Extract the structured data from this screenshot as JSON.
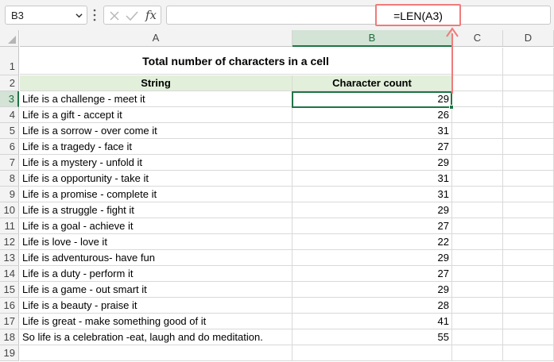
{
  "namebox": {
    "value": "B3"
  },
  "formula_bar": {
    "fx_label": "fx",
    "formula": "=LEN(A3)"
  },
  "columns": [
    "A",
    "B",
    "C",
    "D"
  ],
  "rows": [
    "1",
    "2",
    "3",
    "4",
    "5",
    "6",
    "7",
    "8",
    "9",
    "10",
    "11",
    "12",
    "13",
    "14",
    "15",
    "16",
    "17",
    "18",
    "19"
  ],
  "sheet": {
    "title": "Total number of characters in a cell",
    "header_string": "String",
    "header_count": "Character count",
    "data": [
      {
        "string": "Life is a challenge - meet it",
        "count": "29"
      },
      {
        "string": "Life is a gift - accept it",
        "count": "26"
      },
      {
        "string": "Life is a sorrow - over come it",
        "count": "31"
      },
      {
        "string": "Life is a tragedy - face it",
        "count": "27"
      },
      {
        "string": "Life is a mystery - unfold it",
        "count": "29"
      },
      {
        "string": "Life is a opportunity - take it",
        "count": "31"
      },
      {
        "string": "Life is a promise - complete it",
        "count": "31"
      },
      {
        "string": "Life is a struggle - fight it",
        "count": "29"
      },
      {
        "string": "Life is a goal - achieve it",
        "count": "27"
      },
      {
        "string": "Life is love - love it",
        "count": "22"
      },
      {
        "string": "Life is adventurous- have fun",
        "count": "29"
      },
      {
        "string": "Life is a duty - perform it",
        "count": "27"
      },
      {
        "string": "Life is a game - out smart it",
        "count": "29"
      },
      {
        "string": "Life is a beauty - praise it",
        "count": "28"
      },
      {
        "string": "Life is great - make something good of it",
        "count": "41"
      },
      {
        "string": "So life is a celebration -eat, laugh and do meditation.",
        "count": "55"
      }
    ]
  },
  "colors": {
    "accent": "#217346",
    "callout": "#ef7b7b",
    "header_fill": "#e2efda"
  }
}
